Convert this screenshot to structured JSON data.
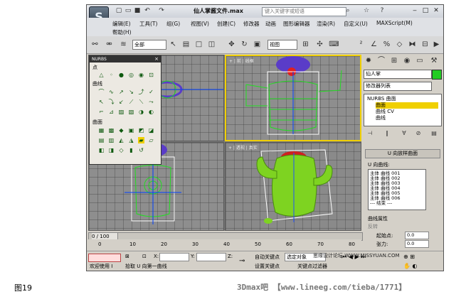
{
  "window": {
    "title": "仙人掌酱文件.max",
    "search_placeholder": "键入关键字或短语"
  },
  "menus": [
    "编辑(E)",
    "工具(T)",
    "组(G)",
    "视图(V)",
    "创建(C)",
    "修改器",
    "动画",
    "图形编辑器",
    "渲染(R)",
    "自定义(U)",
    "MAXScript(M)",
    "帮助(H)"
  ],
  "toolbar": {
    "selection_filter": "全部",
    "reference_coord": "视图"
  },
  "nurbs_panel": {
    "title": "NURBS",
    "sections": [
      "点",
      "曲线",
      "曲面"
    ]
  },
  "command_panel": {
    "object_name": "仙人掌",
    "modifier_list": "修改器列表",
    "stack": [
      "NURBS 曲面",
      "曲面",
      "曲线 CV",
      "曲线"
    ],
    "rollout_title": "U 向放样曲面",
    "u_curves_label": "U 向曲线:",
    "u_curves": [
      "主体 曲线 001",
      "主体 曲线 002",
      "主体 曲线 003",
      "主体 曲线 004",
      "主体 曲线 005",
      "主体 曲线 006",
      "--- 结束 ---"
    ],
    "curve_props_label": "曲线属性",
    "reverse_label": "反转",
    "start_point_label": "起始点:",
    "start_point_value": "0.0",
    "tension_label": "张力:",
    "tension_value": "0.0"
  },
  "timeline": {
    "frame_display": "0 / 100",
    "ticks": [
      "0",
      "10",
      "20",
      "30",
      "40",
      "50",
      "60",
      "70",
      "80"
    ]
  },
  "status": {
    "welcome": "欢迎使用 I",
    "prompt": "拾取 U 向第一曲线",
    "x_label": "X:",
    "y_label": "Y:",
    "z_label": "Z:",
    "auto_key": "自动关键点",
    "set_key": "设置关键点",
    "selected_object": "选定对象",
    "key_filter": "关键点过滤器"
  },
  "watermark": {
    "overlay": "思缘设计论坛 WWW.MISSYUAN.COM",
    "site": "3Dmax吧 【www.lineeg.com/tieba/1771】"
  },
  "caption": "图19",
  "colors": {
    "active_border": "#f0d000",
    "wire_green": "#22dd22",
    "cactus_green": "#7ed321",
    "flower_purple": "#5a3cc8"
  }
}
